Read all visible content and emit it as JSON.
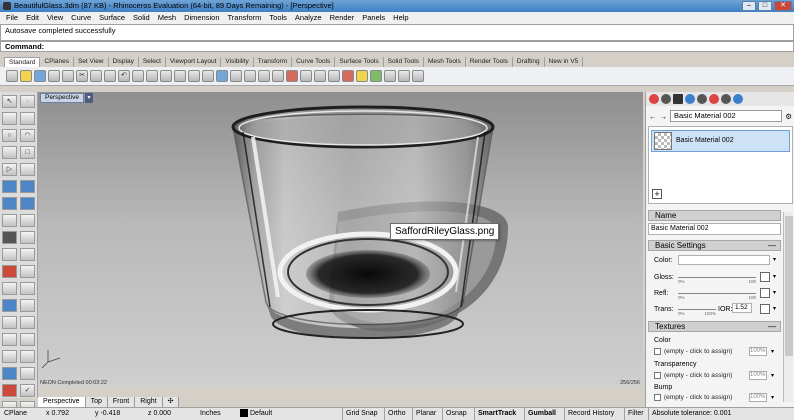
{
  "window": {
    "title": "BeautifulGlass.3dm (87 KB) - Rhinoceros Evaluation (64-bit, 89 Days Remaining) - [Perspective]",
    "minimize": "–",
    "maximize": "□",
    "close": "✕"
  },
  "menu": [
    "File",
    "Edit",
    "View",
    "Curve",
    "Surface",
    "Solid",
    "Mesh",
    "Dimension",
    "Transform",
    "Tools",
    "Analyze",
    "Render",
    "Panels",
    "Help"
  ],
  "command": {
    "history": "Autosave completed successfully",
    "prompt": "Command:"
  },
  "toolbar_tabs": [
    "Standard",
    "CPlanes",
    "Set View",
    "Display",
    "Select",
    "Viewport Layout",
    "Visibility",
    "Transform",
    "Curve Tools",
    "Surface Tools",
    "Solid Tools",
    "Mesh Tools",
    "Render Tools",
    "Drafting",
    "New in V5"
  ],
  "viewport": {
    "name": "Perspective",
    "dropdown": "▾",
    "status_left": "NEON Completed   00:03:22",
    "status_right": "256/256",
    "tooltip": "SaffordRileyGlass.png"
  },
  "viewport_tabs": [
    "Perspective",
    "Top",
    "Front",
    "Right",
    "✣"
  ],
  "statusbar": {
    "cplane": "CPlane",
    "x": "x 0.792",
    "y": "y -0.418",
    "z": "z 0.000",
    "units": "Inches",
    "layer": "Default",
    "toggles": [
      "Grid Snap",
      "Ortho",
      "Planar",
      "Osnap",
      "SmartTrack",
      "Gumball",
      "Record History",
      "Filter"
    ],
    "tolerance": "Absolute tolerance: 0.001"
  },
  "panel": {
    "current_material": "Basic Material 002",
    "list_item": "Basic Material 002",
    "add": "+",
    "name_header": "Name",
    "name_value": "Basic Material 002",
    "basic_settings": "Basic Settings",
    "color_label": "Color:",
    "gloss_label": "Gloss:",
    "refl_label": "Refl:",
    "trans_label": "Trans:",
    "ior_label": "IOR:",
    "ior_value": "1.52",
    "slider_min": "0%",
    "slider_max": "100",
    "trans_max": "100%",
    "textures": "Textures",
    "tex_color": "Color",
    "tex_transparency": "Transparency",
    "tex_bump": "Bump",
    "empty_assign": "(empty - click to assign)",
    "pct": "100%",
    "collapse": "—"
  }
}
